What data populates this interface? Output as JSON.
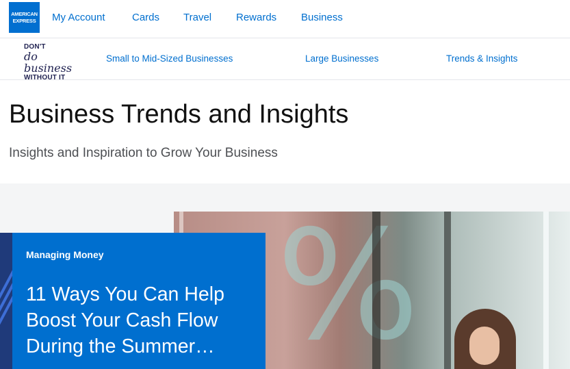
{
  "brand": {
    "logo_line1": "AMERICAN",
    "logo_line2": "EXPRESS",
    "accent_color": "#006fcf"
  },
  "topnav": {
    "items": [
      {
        "label": "My Account"
      },
      {
        "label": "Cards"
      },
      {
        "label": "Travel"
      },
      {
        "label": "Rewards"
      },
      {
        "label": "Business"
      }
    ]
  },
  "subnav": {
    "tagline_top": "DON'T",
    "tagline_mid": "do business",
    "tagline_bottom": "WITHOUT IT",
    "items": [
      {
        "label": "Small to Mid-Sized Businesses"
      },
      {
        "label": "Large Businesses"
      },
      {
        "label": "Trends & Insights"
      }
    ]
  },
  "page": {
    "title": "Business Trends and Insights",
    "subtitle": "Insights and Inspiration to Grow Your Business"
  },
  "feature": {
    "category": "Managing Money",
    "headline": "11 Ways You Can Help Boost Your Cash Flow During the Summer…",
    "hero_glyph": "%"
  }
}
